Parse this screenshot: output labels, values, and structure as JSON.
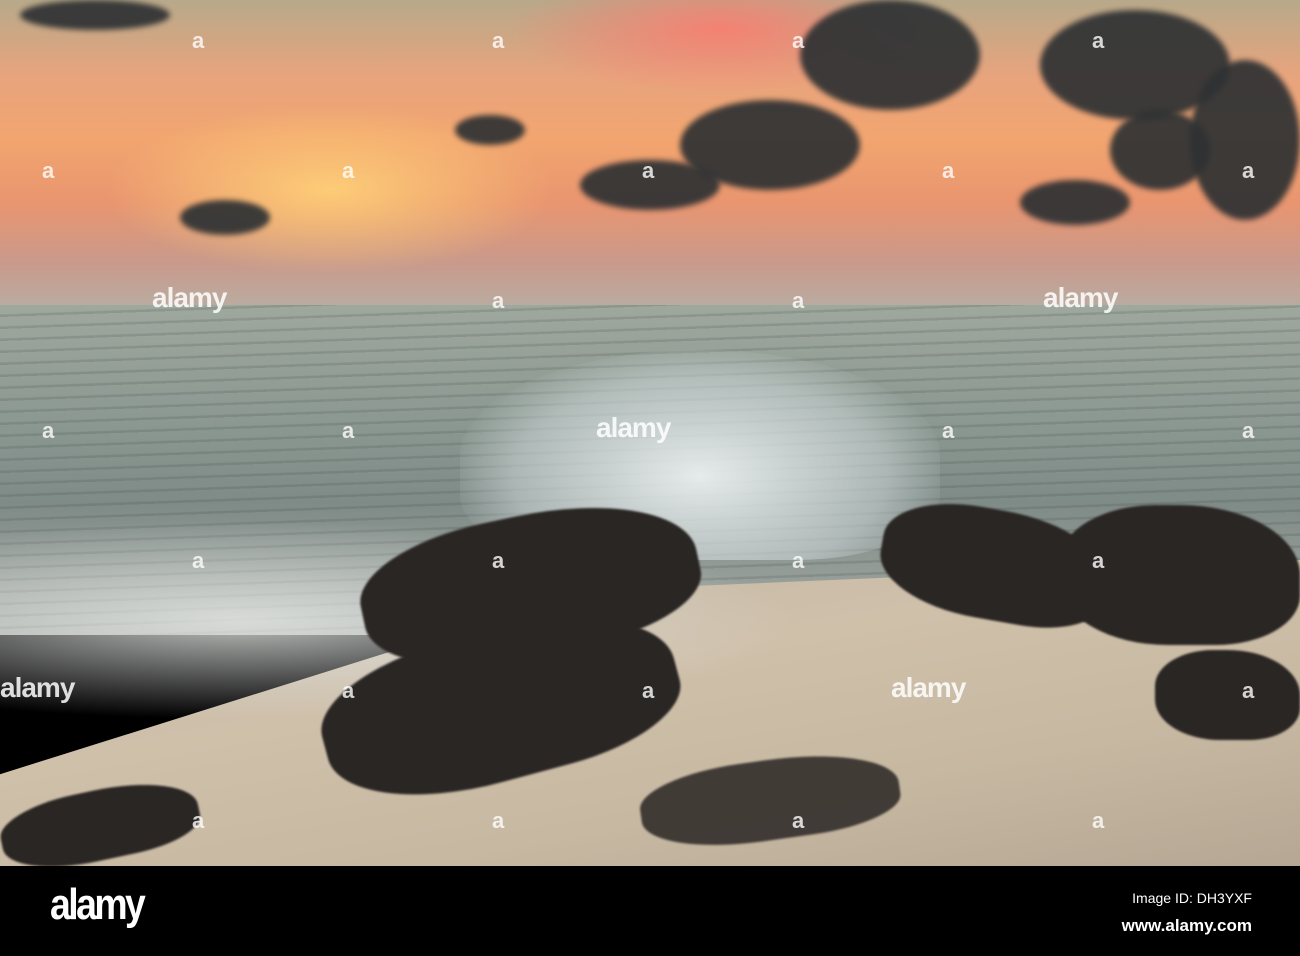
{
  "watermark": {
    "text": "alamy",
    "letter": "a"
  },
  "footer": {
    "logo": "alamy",
    "image_id": "Image ID: DH3YXF",
    "website": "www.alamy.com"
  }
}
